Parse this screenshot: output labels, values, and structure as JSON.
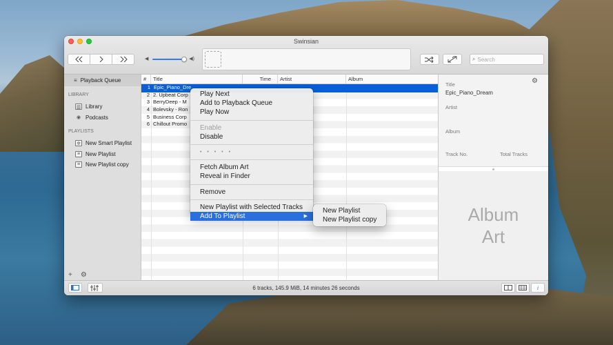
{
  "window": {
    "title": "Swinsian"
  },
  "toolbar": {
    "prev_icon": "rewind-icon",
    "play_icon": "play-icon",
    "next_icon": "fast-forward-icon",
    "volume_level_percent": 80,
    "shuffle_icon": "shuffle-icon",
    "repeat_icon": "crossfade-icon",
    "search_placeholder": "Search"
  },
  "sidebar": {
    "queue_label": "Playback Queue",
    "library_header": "LIBRARY",
    "library_items": [
      {
        "label": "Library",
        "icon": "library-icon"
      },
      {
        "label": "Podcasts",
        "icon": "podcast-icon"
      }
    ],
    "playlists_header": "PLAYLISTS",
    "playlists": [
      {
        "label": "New Smart Playlist",
        "icon": "smart-playlist-icon"
      },
      {
        "label": "New Playlist",
        "icon": "playlist-icon"
      },
      {
        "label": "New Playlist copy",
        "icon": "playlist-icon"
      }
    ],
    "footer": {
      "add": "+",
      "gear": "⚙"
    }
  },
  "tracklist": {
    "columns": [
      "#",
      "Title",
      "Time",
      "Artist",
      "Album"
    ],
    "rows": [
      {
        "num": "1",
        "title": "Epic_Piano_Dre",
        "selected": true
      },
      {
        "num": "2",
        "title": "2. Upbeat Corp",
        "selected": false
      },
      {
        "num": "3",
        "title": "BerryDeep - M",
        "selected": false
      },
      {
        "num": "4",
        "title": "Bolevsky - Ron",
        "selected": false
      },
      {
        "num": "5",
        "title": "Business Corp",
        "selected": false
      },
      {
        "num": "6",
        "title": "Chillout Promo",
        "selected": false
      }
    ]
  },
  "info": {
    "title_label": "Title",
    "title_value": "Epic_Piano_Dream",
    "artist_label": "Artist",
    "album_label": "Album",
    "track_no_label": "Track No.",
    "total_tracks_label": "Total Tracks",
    "album_art_text_1": "Album",
    "album_art_text_2": "Art"
  },
  "status": {
    "text": "6 tracks,  145.9 MiB,  14 minutes 26 seconds"
  },
  "context_menu": {
    "play_next": "Play Next",
    "add_to_queue": "Add to Playback Queue",
    "play_now": "Play Now",
    "enable": "Enable",
    "disable": "Disable",
    "rating": "• • • • •",
    "fetch_album_art": "Fetch Album Art",
    "reveal_in_finder": "Reveal in Finder",
    "remove": "Remove",
    "new_playlist_with_selected": "New Playlist with Selected Tracks",
    "add_to_playlist": "Add To Playlist",
    "submenu_arrow": "▶"
  },
  "submenu": {
    "items": [
      "New Playlist",
      "New Playlist copy"
    ]
  },
  "colors": {
    "selection": "#0a5fd7",
    "menu_highlight": "#2a6fdb"
  }
}
